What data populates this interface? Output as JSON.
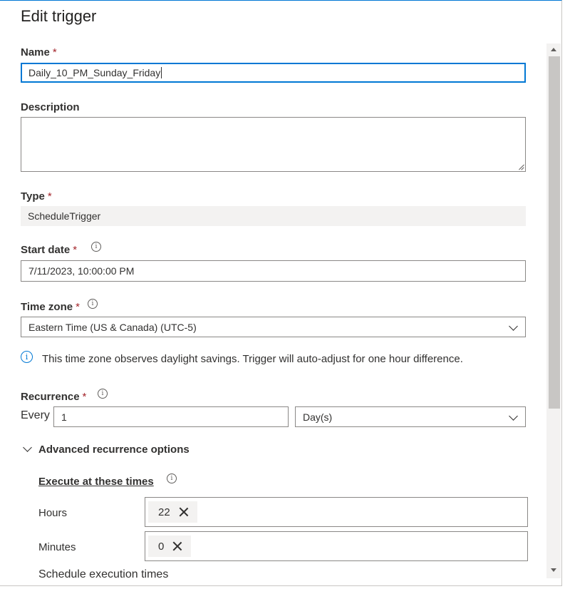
{
  "header": {
    "title": "Edit trigger"
  },
  "name": {
    "label": "Name",
    "required": "*",
    "value": "Daily_10_PM_Sunday_Friday"
  },
  "description": {
    "label": "Description",
    "value": ""
  },
  "type": {
    "label": "Type",
    "required": "*",
    "value": "ScheduleTrigger"
  },
  "start_date": {
    "label": "Start date",
    "required": "*",
    "value": "7/11/2023, 10:00:00 PM"
  },
  "time_zone": {
    "label": "Time zone",
    "required": "*",
    "value": "Eastern Time (US & Canada) (UTC-5)",
    "info": "This time zone observes daylight savings. Trigger will auto-adjust for one hour difference."
  },
  "recurrence": {
    "label": "Recurrence",
    "required": "*",
    "every_label": "Every",
    "interval": "1",
    "unit": "Day(s)"
  },
  "advanced": {
    "toggle_label": "Advanced recurrence options",
    "execute_label": "Execute at these times",
    "hours_label": "Hours",
    "hours_values": [
      "22"
    ],
    "minutes_label": "Minutes",
    "minutes_values": [
      "0"
    ],
    "schedule_label": "Schedule execution times"
  },
  "icons": {
    "info": "info-icon",
    "chevron": "chevron-down-icon",
    "remove": "close-icon"
  },
  "colors": {
    "accent": "#0078d4",
    "required": "#a4262c",
    "readonly_bg": "#f3f2f1"
  }
}
